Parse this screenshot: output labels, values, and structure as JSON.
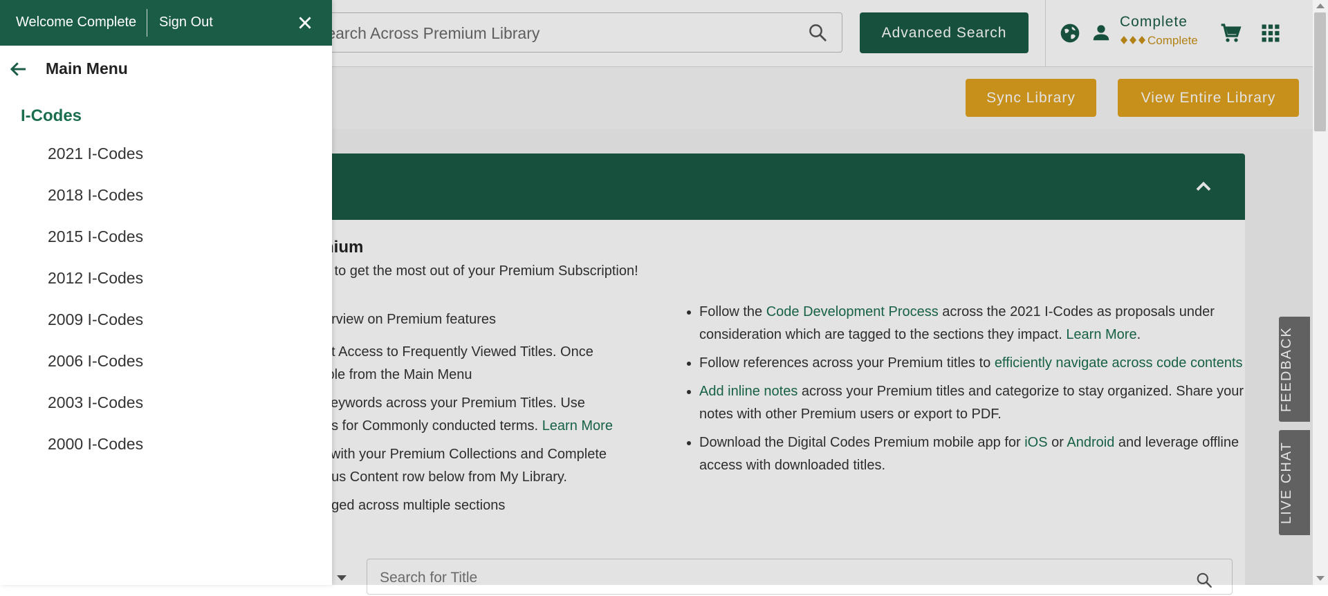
{
  "header": {
    "search_placeholder": "Search Across Premium Library",
    "advanced_search_label": "Advanced Search",
    "user_name": "Complete",
    "user_tier": "Complete"
  },
  "subbar": {
    "sync_label": "Sync Library",
    "view_all_label": "View Entire Library"
  },
  "panel": {
    "title": "nium",
    "subtitle": "s to get the most out of your Premium Subscription!",
    "left_lines": [
      "erview on Premium features",
      "nt Access to Frequently Viewed Titles. Once",
      "ible from the Main Menu",
      "keywords across your Premium Titles. Use",
      "es for Commonly conducted terms.",
      "Learn More",
      "l with your Premium Collections and Complete",
      "nus Content row below from My Library.",
      "gged across multiple sections"
    ],
    "bullets": [
      {
        "pre": "Follow the ",
        "link": "Code Development Process",
        "mid": " across the 2021 I-Codes as proposals under consideration which are tagged to the sections they impact. ",
        "link2": "Learn More",
        "post": "."
      },
      {
        "pre": "Follow references across your Premium titles to ",
        "link": "efficiently navigate across code contents",
        "post": ""
      },
      {
        "link": "Add inline notes",
        "post": " across your Premium titles and categorize to stay organized. Share your notes with other Premium users or export to PDF."
      },
      {
        "pre": "Download the Digital Codes Premium mobile app for ",
        "link": "iOS",
        "mid": " or ",
        "link2": "Android",
        "post": " and leverage offline access with downloaded titles."
      }
    ],
    "title_search_placeholder": "Search for Title"
  },
  "side_tabs": {
    "feedback": "FEEDBACK",
    "live_chat": "LIVE CHAT"
  },
  "drawer": {
    "welcome": "Welcome Complete",
    "sign_out": "Sign Out",
    "menu_title": "Main Menu",
    "section_title": "I-Codes",
    "items": [
      "2021 I-Codes",
      "2018 I-Codes",
      "2015 I-Codes",
      "2012 I-Codes",
      "2009 I-Codes",
      "2006 I-Codes",
      "2003 I-Codes",
      "2000 I-Codes"
    ]
  },
  "colors": {
    "brand_green": "#1a5c45",
    "link_green": "#1a6e4e",
    "gold": "#e0a21f",
    "tier_gold": "#c8921a"
  },
  "icons": [
    "search-icon",
    "globe-icon",
    "user-icon",
    "diamond-icon",
    "cart-icon",
    "apps-grid-icon",
    "chevron-up-icon",
    "close-icon",
    "arrow-left-icon",
    "chevron-down-icon"
  ]
}
